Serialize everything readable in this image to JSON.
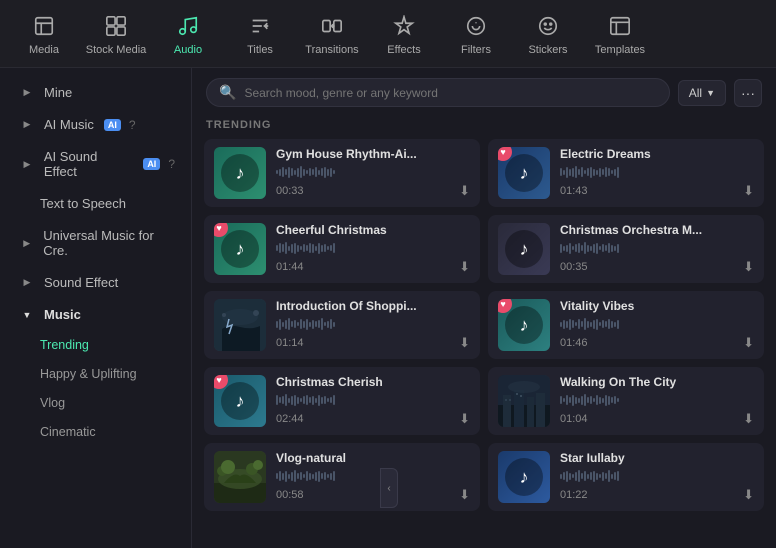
{
  "nav": {
    "items": [
      {
        "id": "media",
        "label": "Media",
        "icon": "media"
      },
      {
        "id": "stock-media",
        "label": "Stock Media",
        "icon": "stock"
      },
      {
        "id": "audio",
        "label": "Audio",
        "icon": "audio",
        "active": true
      },
      {
        "id": "titles",
        "label": "Titles",
        "icon": "titles"
      },
      {
        "id": "transitions",
        "label": "Transitions",
        "icon": "transitions"
      },
      {
        "id": "effects",
        "label": "Effects",
        "icon": "effects"
      },
      {
        "id": "filters",
        "label": "Filters",
        "icon": "filters"
      },
      {
        "id": "stickers",
        "label": "Stickers",
        "icon": "stickers"
      },
      {
        "id": "templates",
        "label": "Templates",
        "icon": "templates"
      }
    ]
  },
  "sidebar": {
    "items": [
      {
        "id": "mine",
        "label": "Mine",
        "type": "collapsible",
        "collapsed": true
      },
      {
        "id": "ai-music",
        "label": "AI Music",
        "badge": "AI",
        "type": "collapsible",
        "collapsed": true
      },
      {
        "id": "ai-sound-effect",
        "label": "AI Sound Effect",
        "badge": "AI",
        "type": "collapsible",
        "collapsed": true
      },
      {
        "id": "text-to-speech",
        "label": "Text to Speech",
        "type": "item"
      },
      {
        "id": "universal-music",
        "label": "Universal Music for Cre.",
        "type": "collapsible",
        "collapsed": true
      },
      {
        "id": "sound-effect",
        "label": "Sound Effect",
        "type": "collapsible",
        "collapsed": true
      },
      {
        "id": "music",
        "label": "Music",
        "type": "collapsible",
        "collapsed": false,
        "children": [
          {
            "id": "trending",
            "label": "Trending",
            "active": true
          },
          {
            "id": "happy-uplifting",
            "label": "Happy & Uplifting"
          },
          {
            "id": "vlog",
            "label": "Vlog"
          },
          {
            "id": "cinematic",
            "label": "Cinematic"
          }
        ]
      }
    ]
  },
  "search": {
    "placeholder": "Search mood, genre or any keyword",
    "filter_label": "All"
  },
  "trending_label": "TRENDING",
  "tracks": [
    {
      "id": "t1",
      "title": "Gym House Rhythm-Ai...",
      "duration": "00:33",
      "thumb": "teal",
      "heart": false
    },
    {
      "id": "t2",
      "title": "Electric Dreams",
      "duration": "01:43",
      "thumb": "blue",
      "heart": true
    },
    {
      "id": "t3",
      "title": "Cheerful Christmas",
      "duration": "01:44",
      "thumb": "teal2",
      "heart": true
    },
    {
      "id": "t4",
      "title": "Christmas Orchestra M...",
      "duration": "00:35",
      "thumb": "dark",
      "heart": false
    },
    {
      "id": "t5",
      "title": "Introduction Of Shoppi...",
      "duration": "01:14",
      "thumb": "photo-storm",
      "heart": false
    },
    {
      "id": "t6",
      "title": "Vitality Vibes",
      "duration": "01:46",
      "thumb": "teal3",
      "heart": true
    },
    {
      "id": "t7",
      "title": "Christmas Cherish",
      "duration": "02:44",
      "thumb": "teal4",
      "heart": true
    },
    {
      "id": "t8",
      "title": "Walking On The City",
      "duration": "01:04",
      "thumb": "photo-city",
      "heart": false
    },
    {
      "id": "t9",
      "title": "Vlog-natural",
      "duration": "00:58",
      "thumb": "photo-nature",
      "heart": false
    },
    {
      "id": "t10",
      "title": "Star Iullaby",
      "duration": "01:22",
      "thumb": "teal5",
      "heart": false
    }
  ]
}
